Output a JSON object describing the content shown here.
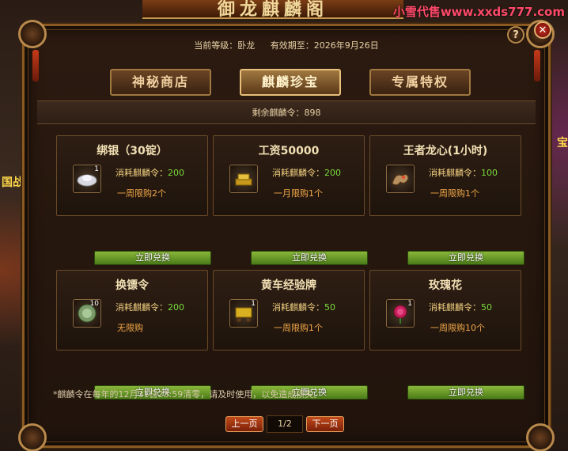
{
  "banner": {
    "title": "御龙麒麟阁"
  },
  "watermark": "小雪代售www.xxds777.com",
  "side": {
    "left_text": "国战",
    "right_text": "宝"
  },
  "header": {
    "level_label": "当前等级：卧龙",
    "expiry_label": "有效期至：2026年9月26日"
  },
  "tabs": [
    {
      "label": "神秘商店"
    },
    {
      "label": "麒麟珍宝"
    },
    {
      "label": "专属特权"
    }
  ],
  "active_tab": 1,
  "remaining": "剩余麒麟令：898",
  "cost_label": "消耗麒麟令：",
  "redeem_label": "立即兑换",
  "items": [
    {
      "name": "绑银（30锭）",
      "icon": "silver-ingot-icon",
      "count": "1",
      "cost": "200",
      "limit": "一周限购2个"
    },
    {
      "name": "工资50000",
      "icon": "gold-ingot-icon",
      "count": "",
      "cost": "200",
      "limit": "一月限购1个"
    },
    {
      "name": "王者龙心(1小时)",
      "icon": "dragon-heart-icon",
      "count": "",
      "cost": "100",
      "limit": "一周限购1个"
    },
    {
      "name": "换镖令",
      "icon": "escort-token-icon",
      "count": "10",
      "cost": "200",
      "limit": "无限购"
    },
    {
      "name": "黄车经验牌",
      "icon": "cart-exp-icon",
      "count": "1",
      "cost": "50",
      "limit": "一周限购1个"
    },
    {
      "name": "玫瑰花",
      "icon": "rose-icon",
      "count": "1",
      "cost": "50",
      "limit": "一周限购10个"
    }
  ],
  "note": "*麒麟令在每年的12月31日23:59清零，请及时使用，以免造成损失。",
  "pager": {
    "prev": "上一页",
    "page": "1/2",
    "next": "下一页"
  },
  "buttons": {
    "help": "?",
    "close": "✕"
  }
}
